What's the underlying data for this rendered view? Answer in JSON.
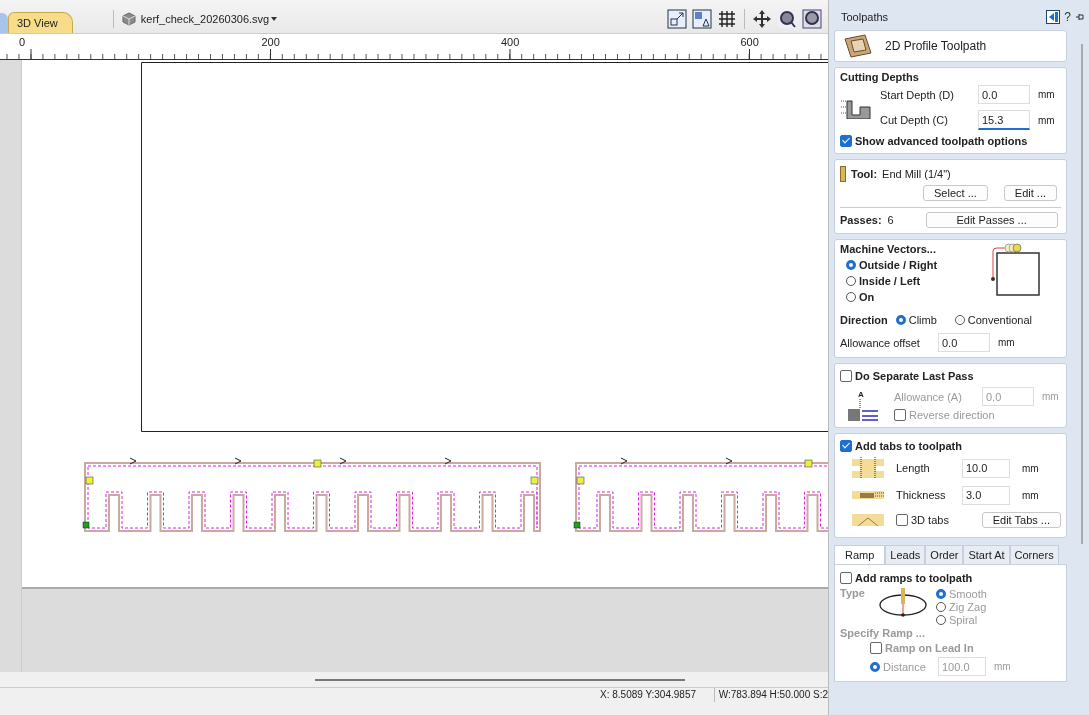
{
  "view_tab": {
    "label": "3D View"
  },
  "document": {
    "filename": "kerf_check_20260306.svg"
  },
  "ruler": {
    "labels": [
      "0",
      "200",
      "400",
      "600"
    ]
  },
  "panel": {
    "title": "Toolpaths",
    "help": "?",
    "toolpath_name": "2D Profile Toolpath",
    "cutting_depths": {
      "title": "Cutting Depths",
      "fields": [
        {
          "label": "Start Depth (D)",
          "value": "0.0",
          "unit": "mm",
          "focused": false
        },
        {
          "label": "Cut Depth (C)",
          "value": "15.3",
          "unit": "mm",
          "focused": true
        }
      ],
      "advanced": {
        "label": "Show advanced toolpath options",
        "checked": true
      }
    },
    "tool": {
      "label": "Tool:",
      "name": "End Mill (1/4\")",
      "buttons": [
        "Select ...",
        "Edit ..."
      ],
      "passes_label": "Passes:",
      "passes": "6",
      "passes_button": "Edit Passes ..."
    },
    "machine_vectors": {
      "title": "Machine Vectors...",
      "options": [
        {
          "label": "Outside / Right",
          "selected": true
        },
        {
          "label": "Inside / Left",
          "selected": false
        },
        {
          "label": "On",
          "selected": false
        }
      ],
      "direction_label": "Direction",
      "directions": [
        {
          "label": "Climb",
          "selected": true
        },
        {
          "label": "Conventional",
          "selected": false
        }
      ],
      "allowance_label": "Allowance offset",
      "allowance": "0.0",
      "unit": "mm"
    },
    "last_pass": {
      "label": "Do Separate Last Pass",
      "checked": false,
      "diagram_label": "A",
      "allowance_label": "Allowance (A)",
      "allowance": "0.0",
      "unit": "mm",
      "reverse": {
        "label": "Reverse direction",
        "checked": false
      }
    },
    "tabs": {
      "label": "Add tabs to toolpath",
      "checked": true,
      "fields": [
        {
          "label": "Length",
          "value": "10.0",
          "unit": "mm"
        },
        {
          "label": "Thickness",
          "value": "3.0",
          "unit": "mm"
        }
      ],
      "tabs_3d": {
        "label": "3D tabs",
        "checked": false
      },
      "button": "Edit Tabs ..."
    },
    "option_tabs": [
      {
        "label": "Ramp",
        "selected": true
      },
      {
        "label": "Leads",
        "selected": false
      },
      {
        "label": "Order",
        "selected": false
      },
      {
        "label": "Start At",
        "selected": false
      },
      {
        "label": "Corners",
        "selected": false
      }
    ],
    "ramp": {
      "label": "Add ramps to toolpath",
      "checked": false,
      "type_label": "Type",
      "types": [
        {
          "label": "Smooth",
          "selected": true
        },
        {
          "label": "Zig Zag",
          "selected": false
        },
        {
          "label": "Spiral",
          "selected": false
        }
      ],
      "specify_label": "Specify Ramp ...",
      "lead_in": {
        "label": "Ramp on Lead In",
        "checked": false
      },
      "distance": {
        "label": "Distance",
        "selected": true,
        "value": "100.0",
        "unit": "mm"
      }
    }
  },
  "status_bar": {
    "position": "X:  8.5089 Y:304.9857",
    "size": "W:783.894  H:50.000  S:2"
  }
}
